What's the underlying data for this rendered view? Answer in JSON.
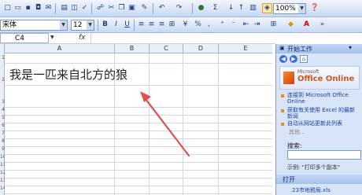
{
  "toolbar": {
    "zoom": "100%",
    "font_name": "宋体",
    "font_size": "12",
    "bold": "B",
    "italic": "I",
    "underline": "U",
    "percent": "%",
    "sigma": "Σ"
  },
  "formula_bar": {
    "name_box": "C4",
    "fx": "fx"
  },
  "columns": [
    "A",
    "B",
    "C",
    "D",
    "E"
  ],
  "rows": [
    "1",
    "2",
    "3",
    "4",
    "5",
    "6",
    "7",
    "8",
    "9",
    "10",
    "11",
    "12",
    "13",
    "14",
    "15",
    "16",
    "17",
    "18"
  ],
  "cell_a2": "我是一匹来自北方的狼",
  "task_pane": {
    "title": "开始工作",
    "office_online": "Office Online",
    "microsoft": "Microsoft",
    "links": [
      "连接到 Microsoft Office Online",
      "获取有关使用 Excel 的最新新闻",
      "自动从网站更新此列表"
    ],
    "more": "其他...",
    "search_label": "搜索:",
    "example": "示例: \"打印多个副本\"",
    "open_label": "打开",
    "recent_file": "23市地税局.xls"
  },
  "colors": {
    "arrow": "#e0504f",
    "office_online": "#d4571a"
  }
}
